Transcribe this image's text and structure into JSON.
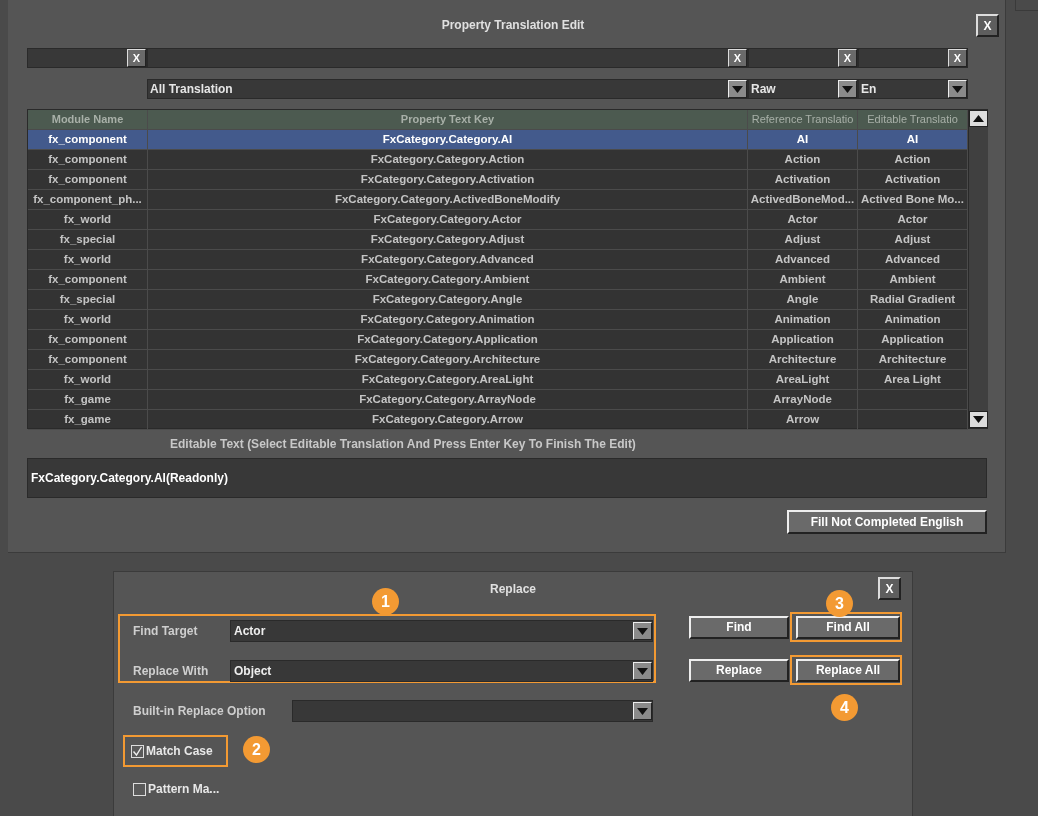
{
  "translation_dialog": {
    "title": "Property Translation Edit",
    "close_label": "X",
    "filters": [
      {
        "clear_label": "X"
      },
      {
        "clear_label": "X"
      },
      {
        "clear_label": "X"
      },
      {
        "clear_label": "X"
      }
    ],
    "dropdowns": [
      {
        "value": "All Translation"
      },
      {
        "value": "Raw"
      },
      {
        "value": "En"
      }
    ],
    "table": {
      "columns": [
        "Module Name",
        "Property Text Key",
        "Reference Translatio",
        "Editable Translatio"
      ],
      "rows": [
        {
          "module": "fx_component",
          "key": "FxCategory.Category.AI",
          "reference": "AI",
          "editable": "AI",
          "selected": true
        },
        {
          "module": "fx_component",
          "key": "FxCategory.Category.Action",
          "reference": "Action",
          "editable": "Action",
          "selected": false
        },
        {
          "module": "fx_component",
          "key": "FxCategory.Category.Activation",
          "reference": "Activation",
          "editable": "Activation",
          "selected": false
        },
        {
          "module": "fx_component_ph...",
          "key": "FxCategory.Category.ActivedBoneModify",
          "reference": "ActivedBoneMod...",
          "editable": "Actived Bone Mo...",
          "selected": false
        },
        {
          "module": "fx_world",
          "key": "FxCategory.Category.Actor",
          "reference": "Actor",
          "editable": "Actor",
          "selected": false
        },
        {
          "module": "fx_special",
          "key": "FxCategory.Category.Adjust",
          "reference": "Adjust",
          "editable": "Adjust",
          "selected": false
        },
        {
          "module": "fx_world",
          "key": "FxCategory.Category.Advanced",
          "reference": "Advanced",
          "editable": "Advanced",
          "selected": false
        },
        {
          "module": "fx_component",
          "key": "FxCategory.Category.Ambient",
          "reference": "Ambient",
          "editable": "Ambient",
          "selected": false
        },
        {
          "module": "fx_special",
          "key": "FxCategory.Category.Angle",
          "reference": "Angle",
          "editable": "Radial Gradient",
          "selected": false
        },
        {
          "module": "fx_world",
          "key": "FxCategory.Category.Animation",
          "reference": "Animation",
          "editable": "Animation",
          "selected": false
        },
        {
          "module": "fx_component",
          "key": "FxCategory.Category.Application",
          "reference": "Application",
          "editable": "Application",
          "selected": false
        },
        {
          "module": "fx_component",
          "key": "FxCategory.Category.Architecture",
          "reference": "Architecture",
          "editable": "Architecture",
          "selected": false
        },
        {
          "module": "fx_world",
          "key": "FxCategory.Category.AreaLight",
          "reference": "AreaLight",
          "editable": "Area Light",
          "selected": false
        },
        {
          "module": "fx_game",
          "key": "FxCategory.Category.ArrayNode",
          "reference": "ArrayNode",
          "selected": false
        },
        {
          "module": "fx_game",
          "key": "FxCategory.Category.Arrow",
          "reference": "Arrow",
          "selected": false
        }
      ]
    },
    "editable_text": {
      "label": "Editable Text (Select Editable Translation And Press Enter Key To Finish The Edit)",
      "value": "FxCategory.Category.AI(Readonly)"
    },
    "fill_button": "Fill Not Completed English"
  },
  "replace_dialog": {
    "title": "Replace",
    "close_label": "X",
    "find_target": {
      "label": "Find Target",
      "value": "Actor"
    },
    "replace_with": {
      "label": "Replace With",
      "value": "Object"
    },
    "builtin_option": {
      "label": "Built-in Replace Option"
    },
    "match_case": {
      "label": "Match Case",
      "checked": true
    },
    "pattern_match": {
      "label": "Pattern Ma...",
      "checked": false
    },
    "buttons": [
      {
        "label": "Find",
        "highlighted": false
      },
      {
        "label": "Find All",
        "highlighted": true
      },
      {
        "label": "Replace",
        "highlighted": false
      },
      {
        "label": "Replace All",
        "highlighted": true
      }
    ],
    "badges": [
      "1",
      "2",
      "3",
      "4"
    ]
  }
}
